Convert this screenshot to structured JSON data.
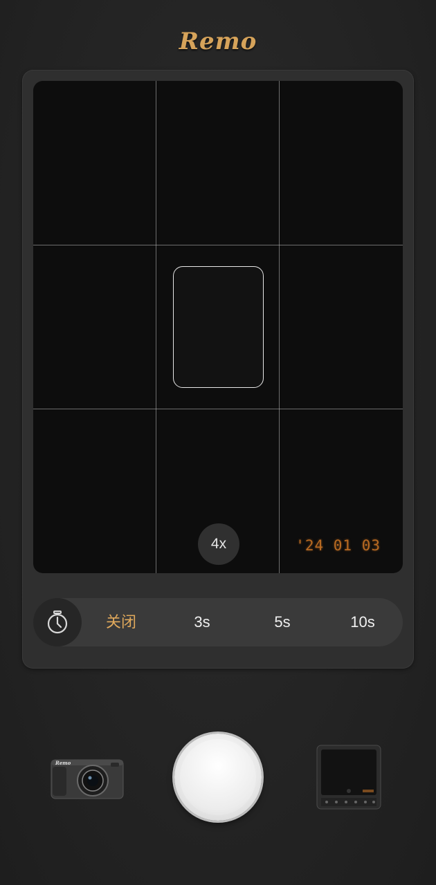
{
  "app": {
    "logo_text": "Remo"
  },
  "viewfinder": {
    "zoom_label": "4x",
    "zoom_button_label": "4x",
    "date_stamp": "'24 01 03"
  },
  "timer": {
    "icon": "timer-icon",
    "options": [
      {
        "label": "关闭",
        "active": true
      },
      {
        "label": "3s",
        "active": false
      },
      {
        "label": "5s",
        "active": false
      },
      {
        "label": "10s",
        "active": false
      }
    ]
  },
  "controls": {
    "camera_model_icon": "camera-icon",
    "camera_badge": "Remo",
    "shutter_icon": "shutter-button",
    "gallery_icon": "gallery-thumbnail"
  },
  "colors": {
    "accent": "#e0a95c",
    "date_stamp": "#b86a22",
    "background": "#242424"
  }
}
